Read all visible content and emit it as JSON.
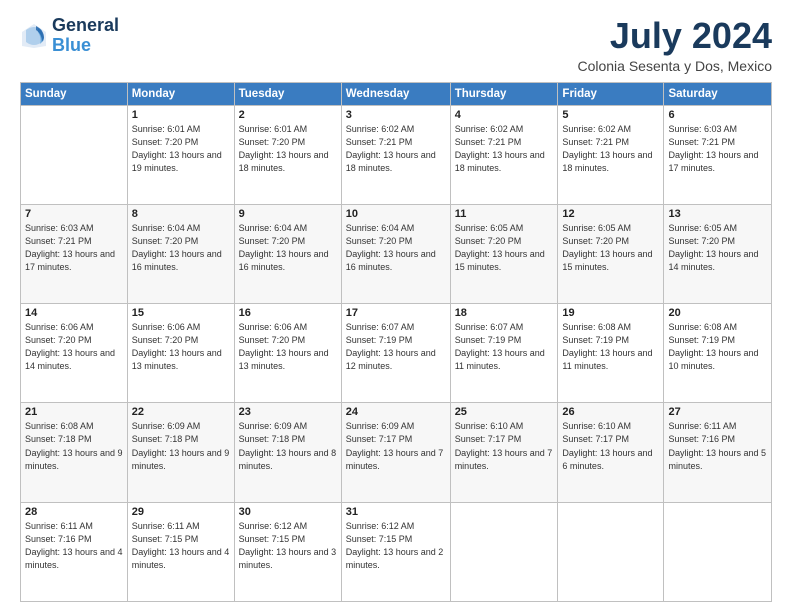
{
  "logo": {
    "line1": "General",
    "line2": "Blue"
  },
  "title": "July 2024",
  "location": "Colonia Sesenta y Dos, Mexico",
  "days_of_week": [
    "Sunday",
    "Monday",
    "Tuesday",
    "Wednesday",
    "Thursday",
    "Friday",
    "Saturday"
  ],
  "weeks": [
    [
      {
        "day": "",
        "sunrise": "",
        "sunset": "",
        "daylight": ""
      },
      {
        "day": "1",
        "sunrise": "Sunrise: 6:01 AM",
        "sunset": "Sunset: 7:20 PM",
        "daylight": "Daylight: 13 hours and 19 minutes."
      },
      {
        "day": "2",
        "sunrise": "Sunrise: 6:01 AM",
        "sunset": "Sunset: 7:20 PM",
        "daylight": "Daylight: 13 hours and 18 minutes."
      },
      {
        "day": "3",
        "sunrise": "Sunrise: 6:02 AM",
        "sunset": "Sunset: 7:21 PM",
        "daylight": "Daylight: 13 hours and 18 minutes."
      },
      {
        "day": "4",
        "sunrise": "Sunrise: 6:02 AM",
        "sunset": "Sunset: 7:21 PM",
        "daylight": "Daylight: 13 hours and 18 minutes."
      },
      {
        "day": "5",
        "sunrise": "Sunrise: 6:02 AM",
        "sunset": "Sunset: 7:21 PM",
        "daylight": "Daylight: 13 hours and 18 minutes."
      },
      {
        "day": "6",
        "sunrise": "Sunrise: 6:03 AM",
        "sunset": "Sunset: 7:21 PM",
        "daylight": "Daylight: 13 hours and 17 minutes."
      }
    ],
    [
      {
        "day": "7",
        "sunrise": "Sunrise: 6:03 AM",
        "sunset": "Sunset: 7:21 PM",
        "daylight": "Daylight: 13 hours and 17 minutes."
      },
      {
        "day": "8",
        "sunrise": "Sunrise: 6:04 AM",
        "sunset": "Sunset: 7:20 PM",
        "daylight": "Daylight: 13 hours and 16 minutes."
      },
      {
        "day": "9",
        "sunrise": "Sunrise: 6:04 AM",
        "sunset": "Sunset: 7:20 PM",
        "daylight": "Daylight: 13 hours and 16 minutes."
      },
      {
        "day": "10",
        "sunrise": "Sunrise: 6:04 AM",
        "sunset": "Sunset: 7:20 PM",
        "daylight": "Daylight: 13 hours and 16 minutes."
      },
      {
        "day": "11",
        "sunrise": "Sunrise: 6:05 AM",
        "sunset": "Sunset: 7:20 PM",
        "daylight": "Daylight: 13 hours and 15 minutes."
      },
      {
        "day": "12",
        "sunrise": "Sunrise: 6:05 AM",
        "sunset": "Sunset: 7:20 PM",
        "daylight": "Daylight: 13 hours and 15 minutes."
      },
      {
        "day": "13",
        "sunrise": "Sunrise: 6:05 AM",
        "sunset": "Sunset: 7:20 PM",
        "daylight": "Daylight: 13 hours and 14 minutes."
      }
    ],
    [
      {
        "day": "14",
        "sunrise": "Sunrise: 6:06 AM",
        "sunset": "Sunset: 7:20 PM",
        "daylight": "Daylight: 13 hours and 14 minutes."
      },
      {
        "day": "15",
        "sunrise": "Sunrise: 6:06 AM",
        "sunset": "Sunset: 7:20 PM",
        "daylight": "Daylight: 13 hours and 13 minutes."
      },
      {
        "day": "16",
        "sunrise": "Sunrise: 6:06 AM",
        "sunset": "Sunset: 7:20 PM",
        "daylight": "Daylight: 13 hours and 13 minutes."
      },
      {
        "day": "17",
        "sunrise": "Sunrise: 6:07 AM",
        "sunset": "Sunset: 7:19 PM",
        "daylight": "Daylight: 13 hours and 12 minutes."
      },
      {
        "day": "18",
        "sunrise": "Sunrise: 6:07 AM",
        "sunset": "Sunset: 7:19 PM",
        "daylight": "Daylight: 13 hours and 11 minutes."
      },
      {
        "day": "19",
        "sunrise": "Sunrise: 6:08 AM",
        "sunset": "Sunset: 7:19 PM",
        "daylight": "Daylight: 13 hours and 11 minutes."
      },
      {
        "day": "20",
        "sunrise": "Sunrise: 6:08 AM",
        "sunset": "Sunset: 7:19 PM",
        "daylight": "Daylight: 13 hours and 10 minutes."
      }
    ],
    [
      {
        "day": "21",
        "sunrise": "Sunrise: 6:08 AM",
        "sunset": "Sunset: 7:18 PM",
        "daylight": "Daylight: 13 hours and 9 minutes."
      },
      {
        "day": "22",
        "sunrise": "Sunrise: 6:09 AM",
        "sunset": "Sunset: 7:18 PM",
        "daylight": "Daylight: 13 hours and 9 minutes."
      },
      {
        "day": "23",
        "sunrise": "Sunrise: 6:09 AM",
        "sunset": "Sunset: 7:18 PM",
        "daylight": "Daylight: 13 hours and 8 minutes."
      },
      {
        "day": "24",
        "sunrise": "Sunrise: 6:09 AM",
        "sunset": "Sunset: 7:17 PM",
        "daylight": "Daylight: 13 hours and 7 minutes."
      },
      {
        "day": "25",
        "sunrise": "Sunrise: 6:10 AM",
        "sunset": "Sunset: 7:17 PM",
        "daylight": "Daylight: 13 hours and 7 minutes."
      },
      {
        "day": "26",
        "sunrise": "Sunrise: 6:10 AM",
        "sunset": "Sunset: 7:17 PM",
        "daylight": "Daylight: 13 hours and 6 minutes."
      },
      {
        "day": "27",
        "sunrise": "Sunrise: 6:11 AM",
        "sunset": "Sunset: 7:16 PM",
        "daylight": "Daylight: 13 hours and 5 minutes."
      }
    ],
    [
      {
        "day": "28",
        "sunrise": "Sunrise: 6:11 AM",
        "sunset": "Sunset: 7:16 PM",
        "daylight": "Daylight: 13 hours and 4 minutes."
      },
      {
        "day": "29",
        "sunrise": "Sunrise: 6:11 AM",
        "sunset": "Sunset: 7:15 PM",
        "daylight": "Daylight: 13 hours and 4 minutes."
      },
      {
        "day": "30",
        "sunrise": "Sunrise: 6:12 AM",
        "sunset": "Sunset: 7:15 PM",
        "daylight": "Daylight: 13 hours and 3 minutes."
      },
      {
        "day": "31",
        "sunrise": "Sunrise: 6:12 AM",
        "sunset": "Sunset: 7:15 PM",
        "daylight": "Daylight: 13 hours and 2 minutes."
      },
      {
        "day": "",
        "sunrise": "",
        "sunset": "",
        "daylight": ""
      },
      {
        "day": "",
        "sunrise": "",
        "sunset": "",
        "daylight": ""
      },
      {
        "day": "",
        "sunrise": "",
        "sunset": "",
        "daylight": ""
      }
    ]
  ]
}
